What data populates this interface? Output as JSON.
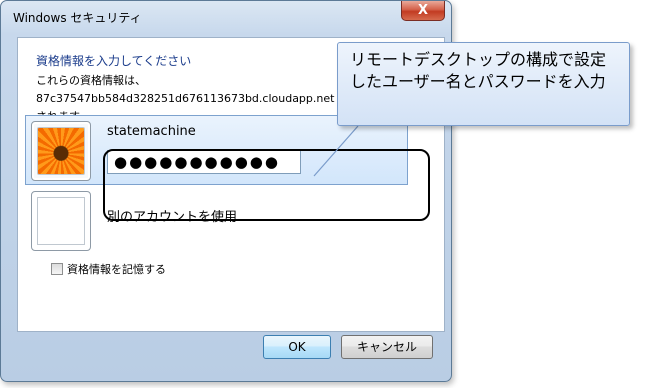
{
  "window": {
    "title": "Windows セキュリティ",
    "close_label": "X"
  },
  "prompt": {
    "heading": "資格情報を入力してください",
    "desc_line1": "これらの資格情報は、",
    "desc_line2": "87c37547bb584d328251d676113673bd.cloudapp.net",
    "desc_line3": "されます。"
  },
  "credential": {
    "username": "statemachine",
    "password_mask": "●●●●●●●●●●●"
  },
  "other_account": {
    "label": "別のアカウントを使用"
  },
  "remember": {
    "label": "資格情報を記憶する",
    "checked": false
  },
  "buttons": {
    "ok": "OK",
    "cancel": "キャンセル"
  },
  "callout": {
    "text": "リモートデスクトップの構成で設定したユーザー名とパスワードを入力"
  },
  "colors": {
    "heading": "#1c3d8c",
    "highlight_outline": "#000000",
    "callout_border": "#7a9ccb"
  }
}
